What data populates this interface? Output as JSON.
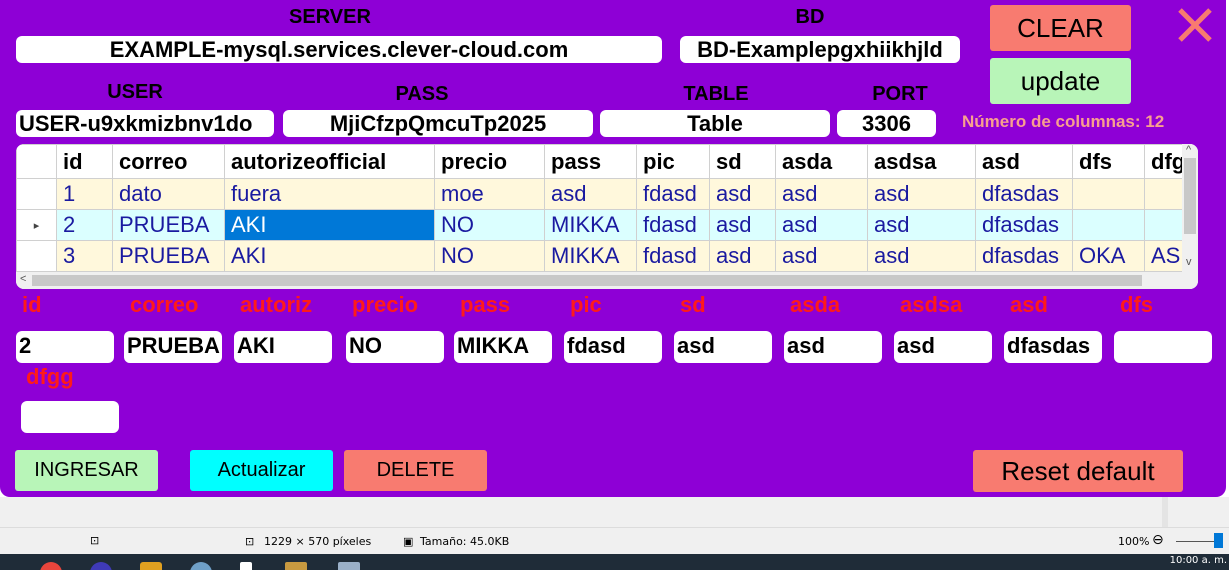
{
  "connection": {
    "server_label": "SERVER",
    "server_value": "EXAMPLE-mysql.services.clever-cloud.com",
    "bd_label": "BD",
    "bd_value": "BD-Examplepgxhiikhjld",
    "user_label": "USER",
    "user_value": "USER-u9xkmizbnv1do",
    "pass_label": "PASS",
    "pass_value": "MjiCfzpQmcuTp2025",
    "table_label": "TABLE",
    "table_value": "Table",
    "port_label": "PORT",
    "port_value": "3306"
  },
  "buttons": {
    "clear": "CLEAR",
    "update": "update",
    "ingresar": "INGRESAR",
    "actualizar": "Actualizar",
    "delete": "DELETE",
    "reset": "Reset default"
  },
  "column_count_text": "Número de columnas: 12",
  "grid": {
    "columns": [
      "id",
      "correo",
      "autorizeofficial",
      "precio",
      "pass",
      "pic",
      "sd",
      "asda",
      "asdsa",
      "asd",
      "dfs",
      "dfg"
    ],
    "rows": [
      [
        "1",
        "dato",
        "fuera",
        "moe",
        "asd",
        "fdasd",
        "asd",
        "asd",
        "asd",
        "dfasdas",
        "",
        ""
      ],
      [
        "2",
        "PRUEBA",
        "AKI",
        "NO",
        "MIKKA",
        "fdasd",
        "asd",
        "asd",
        "asd",
        "dfasdas",
        "",
        ""
      ],
      [
        "3",
        "PRUEBA",
        "AKI",
        "NO",
        "MIKKA",
        "fdasd",
        "asd",
        "asd",
        "asd",
        "dfasdas",
        "OKA",
        "AS"
      ]
    ],
    "selected_row": 1,
    "selected_col": 2
  },
  "editor": {
    "labels": [
      "id",
      "correo",
      "autoriz",
      "precio",
      "pass",
      "pic",
      "sd",
      "asda",
      "asdsa",
      "asd",
      "dfs",
      "dfgg"
    ],
    "values": [
      "2",
      "PRUEBA",
      "AKI",
      "NO",
      "MIKKA",
      "fdasd",
      "asd",
      "asd",
      "asd",
      "dfasdas",
      "",
      ""
    ]
  },
  "statusbar": {
    "dimensions": "1229 × 570 píxeles",
    "size": "Tamaño: 45.0KB",
    "zoom": "100%"
  },
  "taskbar": {
    "clock": "10:00 a. m."
  },
  "colors": {
    "background": "#8e00d6",
    "clear": "#f87b70",
    "update": "#b8f5b8",
    "actualizar": "#00ffff",
    "selected_cell": "#0078d7",
    "close_x": "#f87b70",
    "field_label": "#ff1a1a"
  }
}
